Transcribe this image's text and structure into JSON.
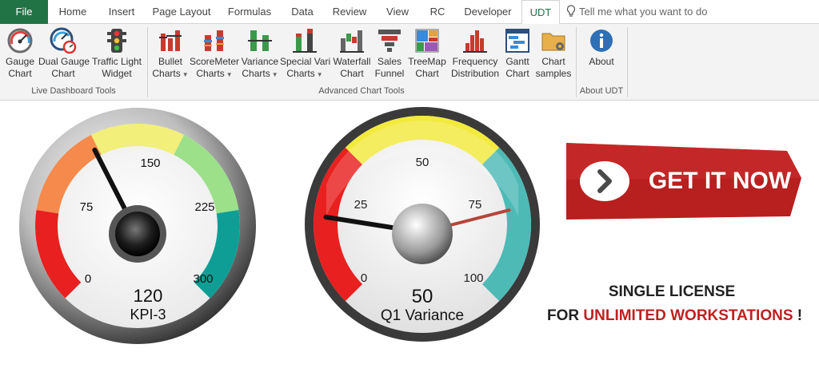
{
  "tabs": [
    {
      "label": "File"
    },
    {
      "label": "Home"
    },
    {
      "label": "Insert"
    },
    {
      "label": "Page Layout"
    },
    {
      "label": "Formulas"
    },
    {
      "label": "Data"
    },
    {
      "label": "Review"
    },
    {
      "label": "View"
    },
    {
      "label": "RC"
    },
    {
      "label": "Developer"
    },
    {
      "label": "UDT"
    }
  ],
  "tell_me_placeholder": "Tell me what you want to do",
  "ribbon": {
    "live_dashboard": {
      "group_label": "Live Dashboard Tools",
      "buttons": [
        {
          "line1": "Gauge",
          "line2": "Chart",
          "icon": "gauge-icon"
        },
        {
          "line1": "Dual Gauge",
          "line2": "Chart",
          "icon": "dual-gauge-icon"
        },
        {
          "line1": "Traffic Light",
          "line2": "Widget",
          "icon": "traffic-light-icon"
        }
      ]
    },
    "advanced": {
      "group_label": "Advanced Chart Tools",
      "buttons": [
        {
          "line1": "Bullet",
          "line2": "Charts",
          "icon": "bullet-chart-icon",
          "dropdown": true
        },
        {
          "line1": "ScoreMeter",
          "line2": "Charts",
          "icon": "scoremeter-icon",
          "dropdown": true
        },
        {
          "line1": "Variance",
          "line2": "Charts",
          "icon": "variance-chart-icon",
          "dropdown": true
        },
        {
          "line1": "Special Vari",
          "line2": "Charts",
          "icon": "special-variance-icon",
          "dropdown": true
        },
        {
          "line1": "Waterfall",
          "line2": "Chart",
          "icon": "waterfall-chart-icon"
        },
        {
          "line1": "Sales",
          "line2": "Funnel",
          "icon": "sales-funnel-icon"
        },
        {
          "line1": "TreeMap",
          "line2": "Chart",
          "icon": "treemap-icon"
        },
        {
          "line1": "Frequency",
          "line2": "Distribution",
          "icon": "frequency-distribution-icon"
        },
        {
          "line1": "Gantt",
          "line2": "Chart",
          "icon": "gantt-chart-icon"
        },
        {
          "line1": "Chart",
          "line2": "samples",
          "icon": "chart-samples-icon"
        }
      ]
    },
    "about": {
      "group_label": "About UDT",
      "buttons": [
        {
          "line1": "About",
          "line2": "",
          "icon": "info-icon"
        }
      ]
    }
  },
  "gauges": [
    {
      "value": "120",
      "label": "KPI-3",
      "ticks": [
        "0",
        "75",
        "150",
        "225",
        "300"
      ],
      "needle_value": 120,
      "max": 300,
      "colors": [
        "#e8201f",
        "#f58a4c",
        "#f2ef7a",
        "#9de08a",
        "#0e9e96"
      ]
    },
    {
      "value": "50",
      "label": "Q1 Variance",
      "ticks": [
        "0",
        "25",
        "50",
        "75",
        "100"
      ],
      "needle_value": 20,
      "target_value": 78,
      "max": 100,
      "colors": [
        "#e8201f",
        "#f2ea3c",
        "#4ebab6"
      ]
    }
  ],
  "cta": {
    "label": "GET IT NOW",
    "color": "#c0201f"
  },
  "license": {
    "line1": "SINGLE LICENSE",
    "line2_prefix": "FOR ",
    "line2_highlight": "UNLIMITED WORKSTATIONS",
    "line2_suffix": " !"
  },
  "colors": {
    "excel_green": "#217346",
    "accent_red": "#c0201f"
  }
}
